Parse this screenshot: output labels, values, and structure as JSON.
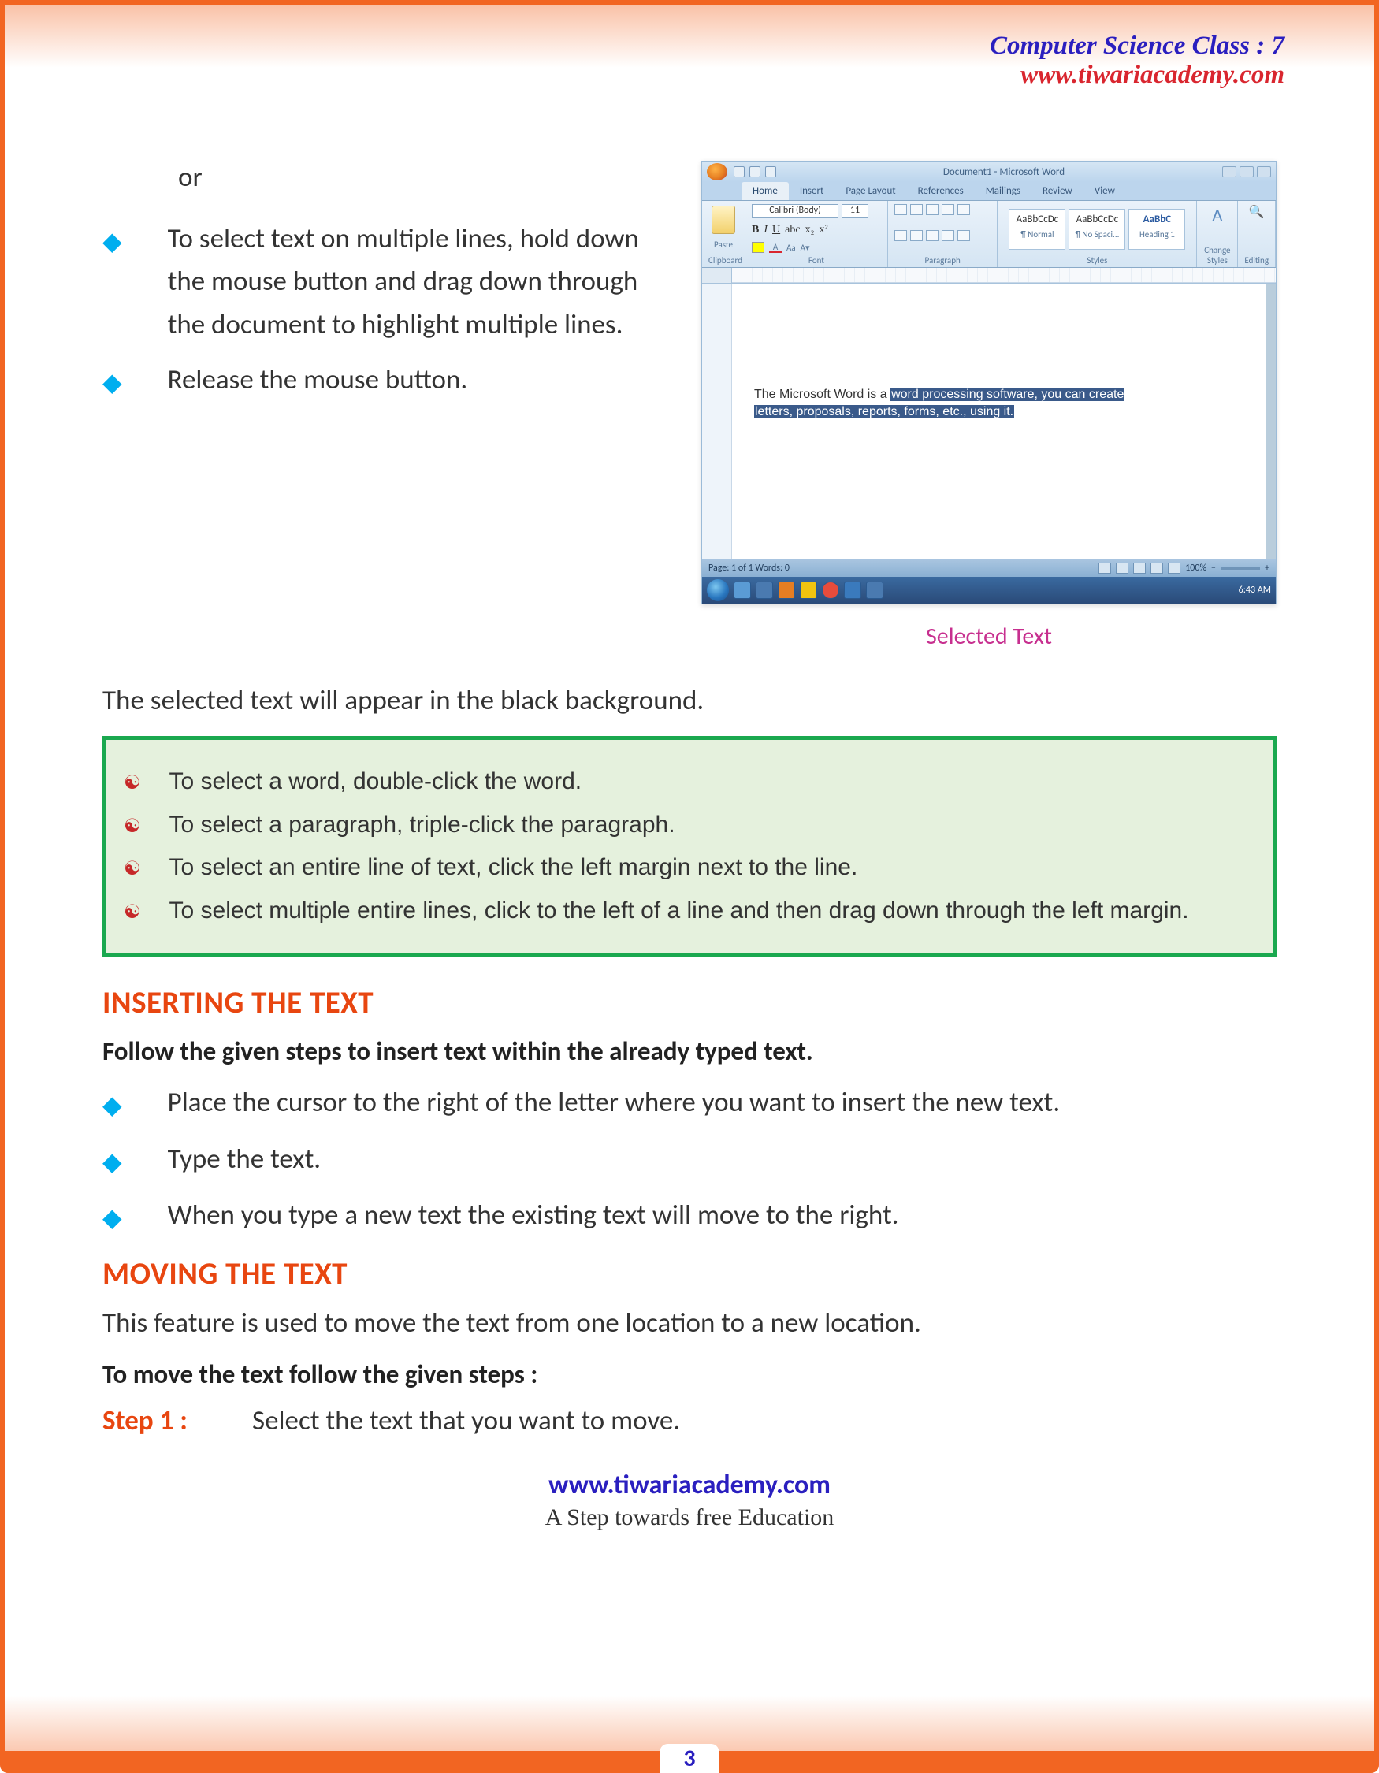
{
  "header": {
    "class_title": "Computer Science Class : 7",
    "site": "www.tiwariacademy.com"
  },
  "section1": {
    "or": "or",
    "bullets": [
      "To select text on multiple lines, hold down the mouse button and drag down through the document to highlight multiple lines.",
      "Release the mouse button."
    ]
  },
  "screenshot": {
    "doc_title": "Document1 - Microsoft Word",
    "tabs": [
      "Home",
      "Insert",
      "Page Layout",
      "References",
      "Mailings",
      "Review",
      "View"
    ],
    "font_name": "Calibri (Body)",
    "font_size": "11",
    "groups": {
      "clipboard": "Clipboard",
      "paste": "Paste",
      "font": "Font",
      "paragraph": "Paragraph",
      "styles": "Styles",
      "change": "Change Styles",
      "editing": "Editing"
    },
    "styleA": "AaBbCcDc",
    "styleB": "AaBbCcDc",
    "styleC": "AaBbC",
    "styleA_n": "¶ Normal",
    "styleB_n": "¶ No Spaci...",
    "styleC_n": "Heading 1",
    "doc_text_plain": "The  Microsoft Word is a ",
    "doc_text_sel1": "word processing software, you can create",
    "doc_text_sel2": "letters, proposals, reports, forms, etc., using it.",
    "status_left": "Page: 1 of 1    Words: 0",
    "zoom": "100%",
    "time": "6:43 AM"
  },
  "caption": "Selected Text",
  "after_caption": "The selected text will appear in the black background.",
  "tips": [
    "To select a word, double-click the word.",
    "To select a paragraph, triple-click the paragraph.",
    "To select an entire line of text, click the left margin next to the line.",
    "To select multiple entire lines, click to the left of a line and then drag down through the left margin."
  ],
  "insert": {
    "heading": "INSERTING THE TEXT",
    "lead": "Follow the given steps to insert text within the already typed text.",
    "bullets": [
      "Place the cursor to the right of the letter where you want to insert the new text.",
      "Type the text.",
      "When you type a new text the existing text will move to the right."
    ]
  },
  "moving": {
    "heading": "MOVING THE TEXT",
    "lead": "This feature is used to move the text from one location to a new location.",
    "lead2": "To move the text follow the given steps :",
    "step1_label": "Step 1 :",
    "step1_text": "Select the text that you want to move."
  },
  "footer": {
    "link": "www.tiwariacademy.com",
    "tag": "A Step towards free Education"
  },
  "page_num": "3"
}
